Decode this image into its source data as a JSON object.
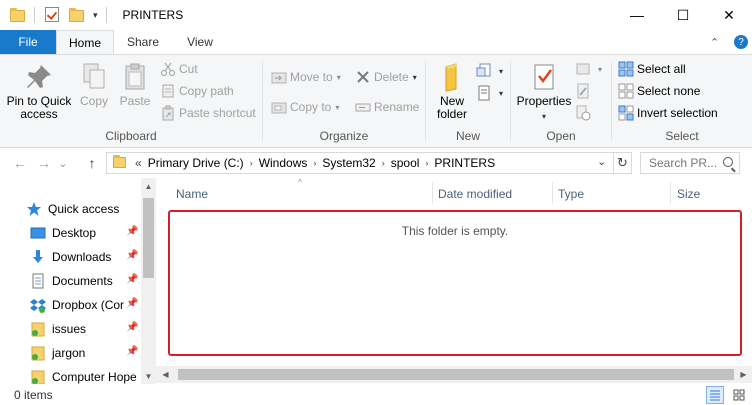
{
  "window": {
    "title": "PRINTERS",
    "minimize_glyph": "—",
    "maximize_glyph": "☐",
    "close_glyph": "✕"
  },
  "quick_access_toolbar": {
    "dropdown_glyph": "▾"
  },
  "ribbon_tabs": [
    {
      "label": "File"
    },
    {
      "label": "Home"
    },
    {
      "label": "Share"
    },
    {
      "label": "View"
    }
  ],
  "ribbon_controls": {
    "collapse_glyph": "⌃",
    "help_glyph": "?"
  },
  "ribbon": {
    "clipboard": {
      "label": "Clipboard",
      "pin_to_quick_access_line1": "Pin to Quick",
      "pin_to_quick_access_line2": "access",
      "copy": "Copy",
      "paste": "Paste",
      "cut": "Cut",
      "copy_path": "Copy path",
      "paste_shortcut": "Paste shortcut"
    },
    "organize": {
      "label": "Organize",
      "move_to": "Move to",
      "copy_to": "Copy to",
      "delete": "Delete",
      "rename": "Rename"
    },
    "new": {
      "label": "New",
      "new_folder_line1": "New",
      "new_folder_line2": "folder"
    },
    "open": {
      "label": "Open",
      "properties": "Properties"
    },
    "select": {
      "label": "Select",
      "select_all": "Select all",
      "select_none": "Select none",
      "invert_selection": "Invert selection"
    }
  },
  "navigation": {
    "back_glyph": "←",
    "forward_glyph": "→",
    "recent_glyph": "⌄",
    "up_glyph": "↑",
    "overflow_glyph": "«",
    "breadcrumbs": [
      {
        "label": "Primary Drive (C:)"
      },
      {
        "label": "Windows"
      },
      {
        "label": "System32"
      },
      {
        "label": "spool"
      },
      {
        "label": "PRINTERS"
      }
    ],
    "separator_glyph": "›",
    "address_dropdown_glyph": "⌄",
    "refresh_glyph": "↻",
    "search_placeholder": "Search PR..."
  },
  "nav_pane": {
    "quick_access": "Quick access",
    "items": [
      {
        "label": "Desktop"
      },
      {
        "label": "Downloads"
      },
      {
        "label": "Documents"
      },
      {
        "label": "Dropbox (Cor"
      },
      {
        "label": "issues"
      },
      {
        "label": "jargon"
      },
      {
        "label": "Computer Hope"
      }
    ],
    "pin_glyph": "📌"
  },
  "file_list": {
    "columns": [
      {
        "label": "Name"
      },
      {
        "label": "Date modified"
      },
      {
        "label": "Type"
      },
      {
        "label": "Size"
      }
    ],
    "sort_glyph": "^",
    "empty_message": "This folder is empty."
  },
  "status_bar": {
    "item_count": "0 items"
  },
  "scroll_glyphs": {
    "up": "▲",
    "down": "▼",
    "left": "◀",
    "right": "▶"
  },
  "colors": {
    "file_tab": "#1979ca",
    "empty_highlight": "#d0202a",
    "column_header_text": "#4c607a"
  }
}
